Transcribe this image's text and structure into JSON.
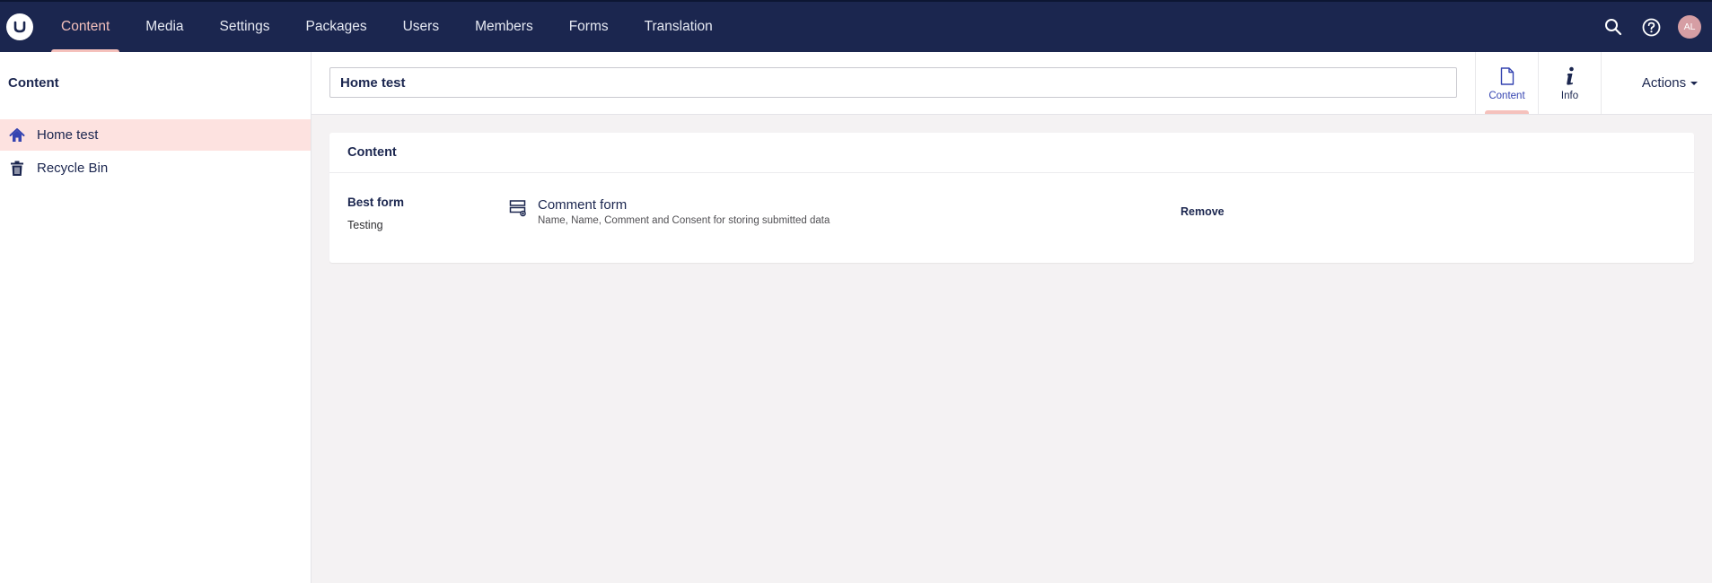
{
  "header": {
    "logo_icon": "umbraco-logo-icon",
    "sections": [
      {
        "label": "Content",
        "active": true
      },
      {
        "label": "Media"
      },
      {
        "label": "Settings"
      },
      {
        "label": "Packages"
      },
      {
        "label": "Users"
      },
      {
        "label": "Members"
      },
      {
        "label": "Forms"
      },
      {
        "label": "Translation"
      }
    ],
    "search_icon": "search-icon",
    "help_icon": "help-icon",
    "avatar_initials": "AL"
  },
  "sidebar": {
    "title": "Content",
    "items": [
      {
        "label": "Home test",
        "icon": "home-icon",
        "selected": true
      },
      {
        "label": "Recycle Bin",
        "icon": "trash-icon"
      }
    ]
  },
  "editor": {
    "name_value": "Home test",
    "apps": [
      {
        "label": "Content",
        "icon": "document-icon",
        "active": true
      },
      {
        "label": "Info",
        "icon": "info-icon"
      }
    ],
    "actions_label": "Actions",
    "group_title": "Content",
    "property": {
      "label": "Best form",
      "description": "Testing",
      "picked": {
        "name": "Comment form",
        "details": "Name, Name, Comment and Consent for storing submitted data",
        "icon": "form-icon"
      },
      "remove_label": "Remove"
    }
  },
  "colors": {
    "header_bg": "#1b264f",
    "accent_pink": "#f5c1bc",
    "selected_bg": "#fde2e0",
    "avatar_bg": "#d69ea4",
    "page_bg": "#f4f2f3"
  }
}
